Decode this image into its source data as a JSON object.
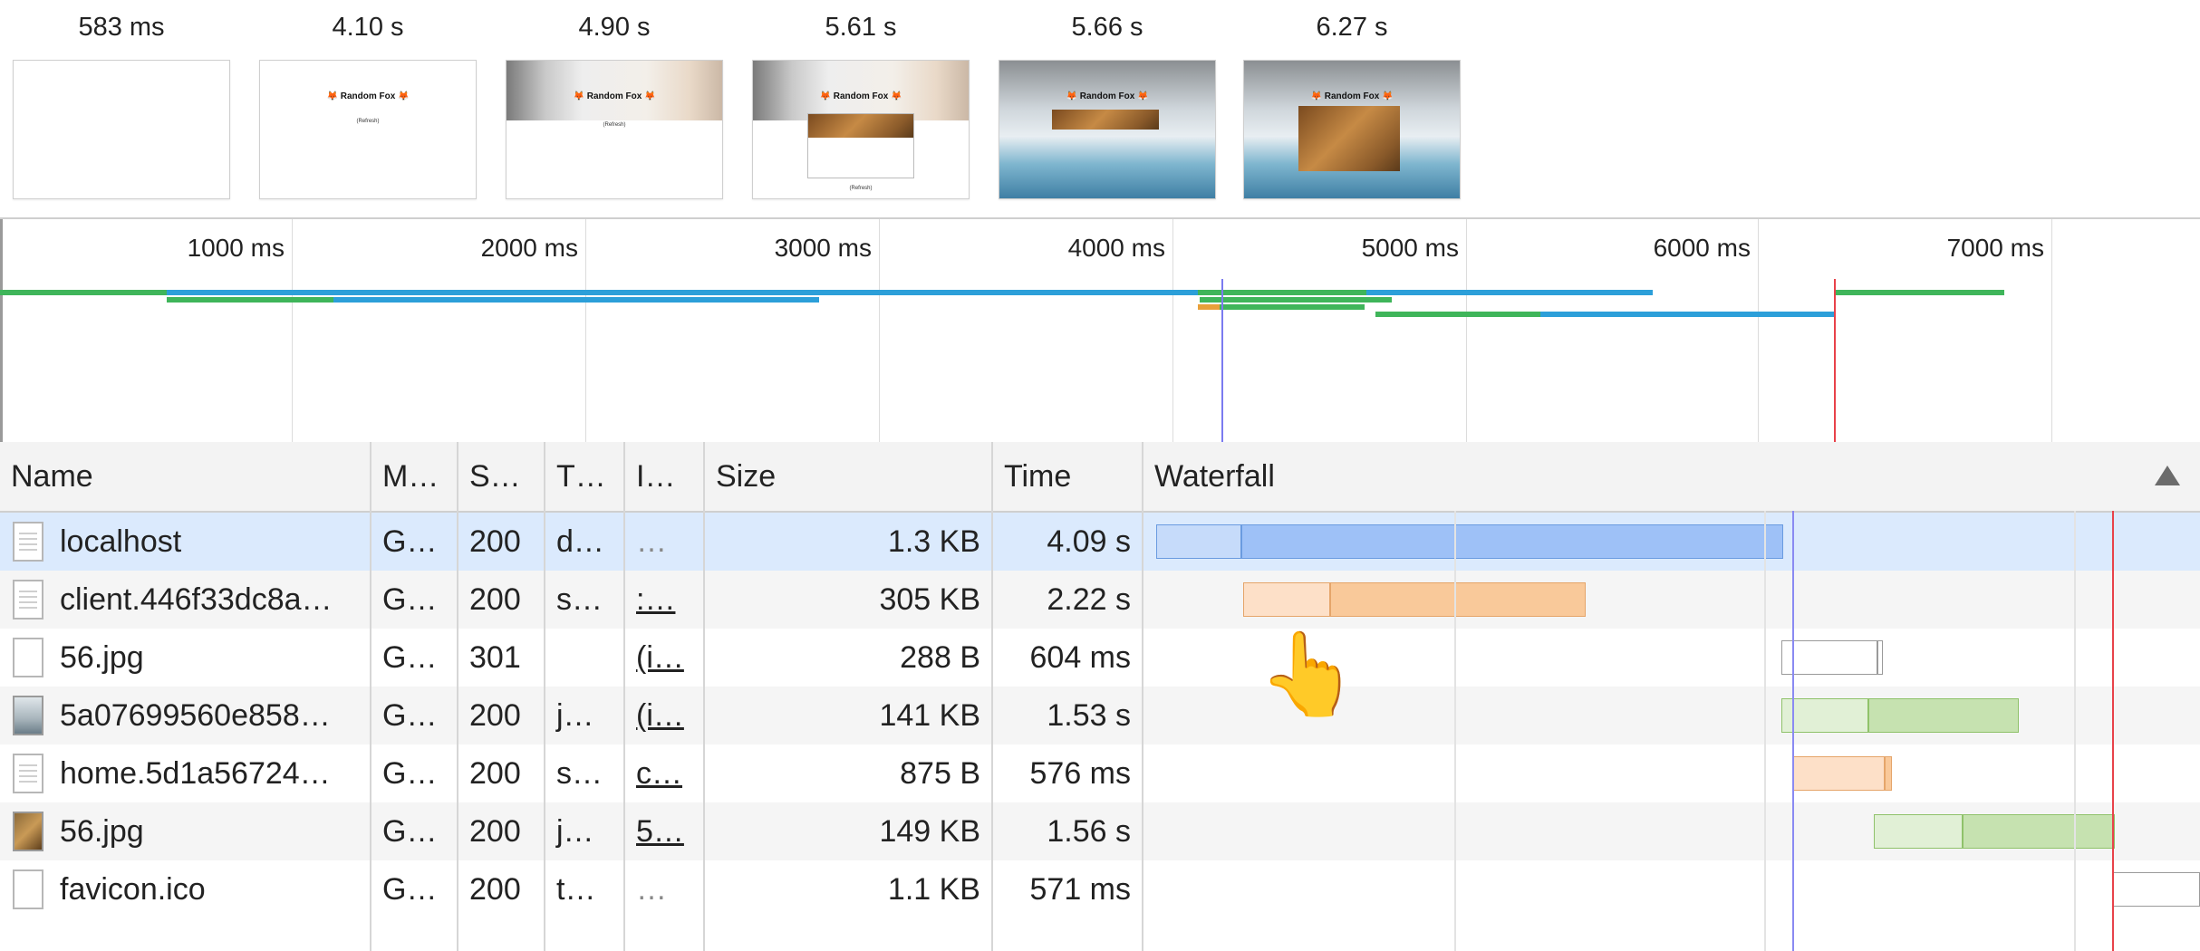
{
  "filmstrip": {
    "frames": [
      {
        "time": "583 ms",
        "kind": "blank"
      },
      {
        "time": "4.10 s",
        "kind": "title"
      },
      {
        "time": "4.90 s",
        "kind": "header"
      },
      {
        "time": "5.61 s",
        "kind": "card"
      },
      {
        "time": "5.66 s",
        "kind": "snow-strip"
      },
      {
        "time": "6.27 s",
        "kind": "snow-fox"
      }
    ],
    "thumb_title": "Random Fox",
    "thumb_sub": "(Refresh)"
  },
  "overview": {
    "tick_labels": [
      "1000 ms",
      "2000 ms",
      "3000 ms",
      "4000 ms",
      "5000 ms",
      "6000 ms",
      "7000 ms"
    ],
    "colors": {
      "wait": "#3fb55a",
      "download": "#2c9fd9",
      "dom": "#7b7bf0",
      "load": "#e8424a"
    }
  },
  "table": {
    "columns": {
      "name": "Name",
      "method": "M…",
      "status": "S…",
      "type": "T…",
      "initiator": "I…",
      "size": "Size",
      "time": "Time",
      "waterfall": "Waterfall"
    },
    "rows": [
      {
        "name": "localhost",
        "method": "G…",
        "status": "200",
        "type": "d…",
        "initiator": "…",
        "size": "1.3 KB",
        "time": "4.09 s",
        "icon": "document-icon"
      },
      {
        "name": "client.446f33dc8a…",
        "method": "G…",
        "status": "200",
        "type": "s…",
        "initiator": ":…",
        "size": "305 KB",
        "time": "2.22 s",
        "icon": "script-icon"
      },
      {
        "name": "56.jpg",
        "method": "G…",
        "status": "301",
        "type": "",
        "initiator": "(i…",
        "size": "288 B",
        "time": "604 ms",
        "icon": "blank-file-icon"
      },
      {
        "name": "5a07699560e858…",
        "method": "G…",
        "status": "200",
        "type": "j…",
        "initiator": "(i…",
        "size": "141 KB",
        "time": "1.53 s",
        "icon": "image-thumbnail-icon"
      },
      {
        "name": "home.5d1a56724…",
        "method": "G…",
        "status": "200",
        "type": "s…",
        "initiator": "c…",
        "size": "875 B",
        "time": "576 ms",
        "icon": "script-icon"
      },
      {
        "name": "56.jpg",
        "method": "G…",
        "status": "200",
        "type": "j…",
        "initiator": "5…",
        "size": "149 KB",
        "time": "1.56 s",
        "icon": "image-thumbnail-icon"
      },
      {
        "name": "favicon.ico",
        "method": "G…",
        "status": "200",
        "type": "t…",
        "initiator": "…",
        "size": "1.1 KB",
        "time": "571 ms",
        "icon": "blank-file-icon"
      }
    ],
    "selected_row": 0,
    "waterfall_colors": {
      "document": "#9ec1f7",
      "document_wait": "#c6dbfa",
      "script": "#f9c99a",
      "script_wait": "#fde0c8",
      "image": "#c6e2b0",
      "image_wait": "#e1f0d6",
      "other": "#ffffff"
    }
  },
  "pointer_icon": "hand-pointer-icon"
}
